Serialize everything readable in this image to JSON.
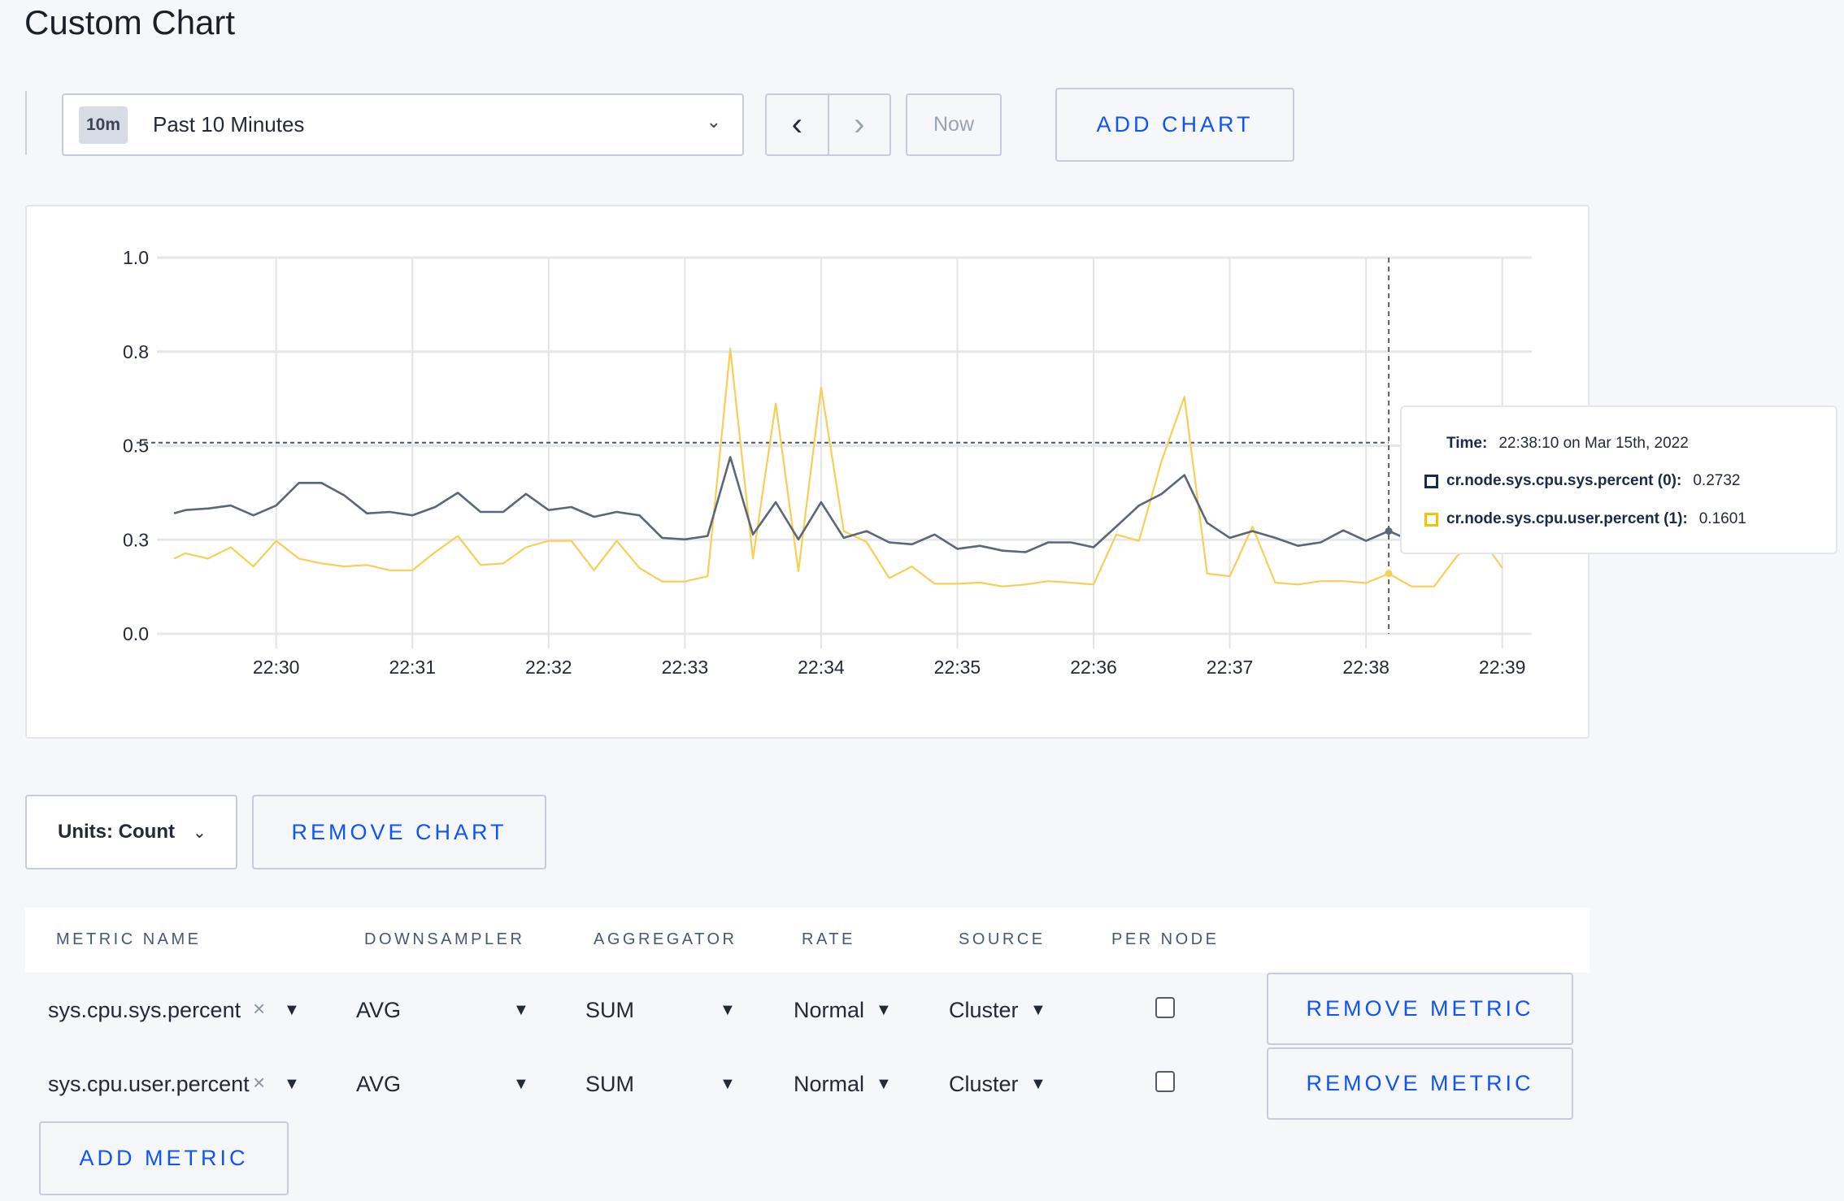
{
  "page": {
    "title": "Custom Chart"
  },
  "toolbar": {
    "time_badge": "10m",
    "time_range": "Past 10 Minutes",
    "prev_icon": "chevron-left-icon",
    "next_icon": "chevron-right-icon",
    "now_label": "Now",
    "add_chart_label": "ADD CHART"
  },
  "tooltip": {
    "time_label": "Time:",
    "time_value": "22:38:10 on Mar 15th, 2022",
    "entries": [
      {
        "name": "cr.node.sys.cpu.sys.percent (0):",
        "value": "0.2732",
        "color": "#1b2a4a"
      },
      {
        "name": "cr.node.sys.cpu.user.percent (1):",
        "value": "0.1601",
        "color": "#f5c400"
      }
    ]
  },
  "chart_data": {
    "type": "line",
    "title": "",
    "xlabel": "",
    "ylabel": "",
    "ylim": [
      0,
      1
    ],
    "xlim": [
      "22:29:15",
      "22:39:13"
    ],
    "grid": true,
    "legend": "none",
    "y_ticks": [
      {
        "value": 0,
        "label": "0.0"
      },
      {
        "value": 0.25,
        "label": "0.3"
      },
      {
        "value": 0.5,
        "label": "0.5"
      },
      {
        "value": 0.75,
        "label": "0.8"
      },
      {
        "value": 1,
        "label": "1.0"
      }
    ],
    "x_ticks": [
      "22:30",
      "22:31",
      "22:32",
      "22:33",
      "22:34",
      "22:35",
      "22:36",
      "22:37",
      "22:38",
      "22:39"
    ],
    "hover_time": "22:38:10",
    "x": [
      "22:29:15",
      "22:29:20",
      "22:29:30",
      "22:29:40",
      "22:29:50",
      "22:30:00",
      "22:30:10",
      "22:30:20",
      "22:30:30",
      "22:30:40",
      "22:30:50",
      "22:31:00",
      "22:31:10",
      "22:31:20",
      "22:31:30",
      "22:31:40",
      "22:31:50",
      "22:32:00",
      "22:32:10",
      "22:32:20",
      "22:32:30",
      "22:32:40",
      "22:32:50",
      "22:33:00",
      "22:33:10",
      "22:33:20",
      "22:33:30",
      "22:33:40",
      "22:33:50",
      "22:34:00",
      "22:34:10",
      "22:34:20",
      "22:34:30",
      "22:34:40",
      "22:34:50",
      "22:35:00",
      "22:35:10",
      "22:35:20",
      "22:35:30",
      "22:35:40",
      "22:35:50",
      "22:36:00",
      "22:36:10",
      "22:36:20",
      "22:36:30",
      "22:36:40",
      "22:36:50",
      "22:37:00",
      "22:37:10",
      "22:37:20",
      "22:37:30",
      "22:37:40",
      "22:37:50",
      "22:38:00",
      "22:38:10",
      "22:38:20",
      "22:38:30",
      "22:38:40",
      "22:38:50",
      "22:39:00"
    ],
    "series": [
      {
        "name": "cr.node.sys.cpu.sys.percent (0)",
        "color": "#5b6679",
        "values": [
          0.32,
          0.329,
          0.333,
          0.341,
          0.315,
          0.341,
          0.401,
          0.401,
          0.368,
          0.32,
          0.324,
          0.315,
          0.337,
          0.375,
          0.324,
          0.324,
          0.372,
          0.329,
          0.337,
          0.311,
          0.324,
          0.315,
          0.255,
          0.251,
          0.26,
          0.47,
          0.264,
          0.35,
          0.251,
          0.35,
          0.255,
          0.273,
          0.243,
          0.238,
          0.264,
          0.226,
          0.234,
          0.221,
          0.217,
          0.243,
          0.243,
          0.23,
          0.285,
          0.341,
          0.372,
          0.422,
          0.295,
          0.255,
          0.273,
          0.255,
          0.234,
          0.243,
          0.275,
          0.247,
          0.2732,
          0.247,
          0.25,
          0.26,
          0.27,
          0.26
        ]
      },
      {
        "name": "cr.node.sys.cpu.user.percent (1)",
        "color": "#f7cf55",
        "values": [
          0.2,
          0.214,
          0.2,
          0.23,
          0.179,
          0.247,
          0.2,
          0.187,
          0.179,
          0.183,
          0.169,
          0.169,
          0.217,
          0.26,
          0.183,
          0.187,
          0.23,
          0.247,
          0.247,
          0.169,
          0.247,
          0.175,
          0.139,
          0.139,
          0.153,
          0.757,
          0.2,
          0.612,
          0.167,
          0.655,
          0.273,
          0.244,
          0.148,
          0.179,
          0.133,
          0.133,
          0.136,
          0.126,
          0.131,
          0.14,
          0.136,
          0.131,
          0.264,
          0.247,
          0.46,
          0.63,
          0.16,
          0.153,
          0.285,
          0.136,
          0.131,
          0.14,
          0.14,
          0.135,
          0.1601,
          0.126,
          0.126,
          0.206,
          0.26,
          0.175
        ]
      }
    ]
  },
  "controls": {
    "units_label": "Units: Count",
    "remove_chart_label": "REMOVE CHART"
  },
  "metrics_table": {
    "headers": [
      "METRIC NAME",
      "DOWNSAMPLER",
      "AGGREGATOR",
      "RATE",
      "SOURCE",
      "PER NODE"
    ],
    "rows": [
      {
        "metric": "sys.cpu.sys.percent",
        "downsampler": "AVG",
        "aggregator": "SUM",
        "rate": "Normal",
        "source": "Cluster",
        "per_node": false,
        "remove_label": "REMOVE METRIC"
      },
      {
        "metric": "sys.cpu.user.percent",
        "downsampler": "AVG",
        "aggregator": "SUM",
        "rate": "Normal",
        "source": "Cluster",
        "per_node": false,
        "remove_label": "REMOVE METRIC"
      }
    ],
    "add_metric_label": "ADD METRIC"
  },
  "colors": {
    "accent": "#0f55f5",
    "background": "#f5f7fa"
  }
}
